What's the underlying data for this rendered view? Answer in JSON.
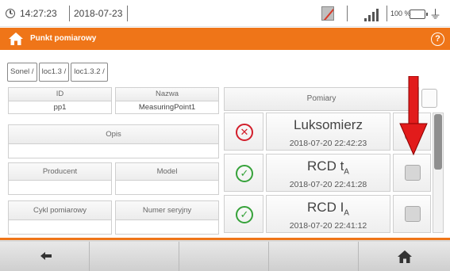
{
  "statusbar": {
    "time": "14:27:23",
    "date": "2018-07-23",
    "battery_percent": "100 %",
    "icons": [
      "clock-icon",
      "sim-card-disabled-icon",
      "signal-bars-icon",
      "battery-icon",
      "power-plug-icon"
    ]
  },
  "header": {
    "title": "Punkt pomiarowy",
    "left_icon": "home-icon",
    "right_icon": "help-icon",
    "help_glyph": "?",
    "color": "#ef7518"
  },
  "breadcrumb": [
    "Sonel /",
    "loc1.3 /",
    "loc1.3.2 /"
  ],
  "form": {
    "id_label": "ID",
    "id_value": "pp1",
    "name_label": "Nazwa",
    "name_value": "MeasuringPoint1",
    "description_label": "Opis",
    "description_value": "",
    "manufacturer_label": "Producent",
    "manufacturer_value": "",
    "model_label": "Model",
    "model_value": "",
    "cycle_label": "Cykl pomiarowy",
    "cycle_value": "",
    "serial_label": "Numer seryjny",
    "serial_value": ""
  },
  "measurements": {
    "header": "Pomiary",
    "items": [
      {
        "name": "Luksomierz",
        "subscript": "",
        "date": "2018-07-20 22:42:23",
        "status": "error",
        "status_glyph": "✕"
      },
      {
        "name": "RCD t",
        "subscript": "A",
        "date": "2018-07-20 22:41:28",
        "status": "ok",
        "status_glyph": "✓"
      },
      {
        "name": "RCD I",
        "subscript": "A",
        "date": "2018-07-20 22:41:12",
        "status": "ok",
        "status_glyph": "✓"
      }
    ],
    "scroll_fraction_visible": 0.46
  },
  "annotation": {
    "icon": "red-arrow-down-icon",
    "color": "#e21b1b"
  },
  "footer": {
    "buttons": [
      "back-arrow-icon",
      "",
      "",
      "",
      "home-icon"
    ]
  },
  "colors": {
    "accent": "#ef7518",
    "error": "#d21e2b",
    "ok": "#36a23a"
  }
}
